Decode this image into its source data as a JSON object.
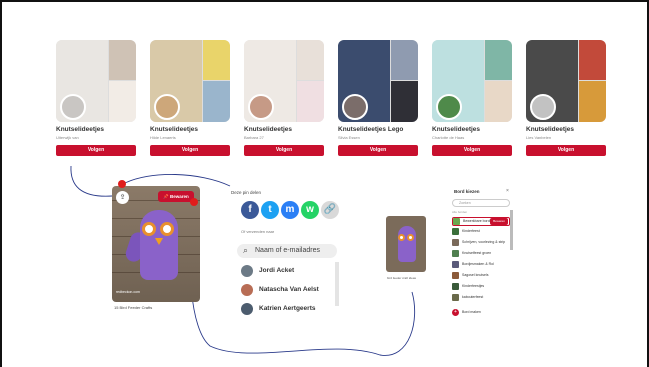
{
  "colors": {
    "accent": "#c8102e",
    "annotation": "#e01c1c",
    "ink": "#2a3a8a"
  },
  "boards": [
    {
      "title": "Knutselideetjes",
      "owner": "Uiterwijk van",
      "follow": "Volgen",
      "img": [
        "#e9e6e2",
        "#cfc2b5",
        "#f2ece6"
      ],
      "avatar": "#c9c6c3"
    },
    {
      "title": "Knutselideetjes",
      "owner": "Hilde Lenaerts",
      "follow": "Volgen",
      "img": [
        "#d9c9a8",
        "#e9d46a",
        "#9ab5cc"
      ],
      "avatar": "#cda77a"
    },
    {
      "title": "Knutselideetjes",
      "owner": "Barbara 27",
      "follow": "Volgen",
      "img": [
        "#eee9e4",
        "#e8e0d9",
        "#f0dfe2"
      ],
      "avatar": "#c69a86"
    },
    {
      "title": "Knutselideetjes Lego",
      "owner": "Silvia Essen",
      "follow": "Volgen",
      "img": [
        "#3b4c6e",
        "#8f9bb0",
        "#2f2f36"
      ],
      "avatar": "#7b6d6a"
    },
    {
      "title": "Knutselideetjes",
      "owner": "Charlotte de Haas",
      "follow": "Volgen",
      "img": [
        "#bde0e0",
        "#7fb6a6",
        "#e8d8c7"
      ],
      "avatar": "#4f8a4a"
    },
    {
      "title": "Knutselideetjes",
      "owner": "Lies Vanbelen",
      "follow": "Volgen",
      "img": [
        "#4a4a4a",
        "#c24a3a",
        "#d79a3a"
      ],
      "avatar": "#c2c2c2"
    }
  ],
  "pin": {
    "share_icon": "upload-icon",
    "share_glyph": "⇪",
    "save_label": "Bewaren",
    "source": "redbeckon.com",
    "caption": "15 Bird Feeder Crafts"
  },
  "share_panel": {
    "header": "Deze pin delen",
    "icons": [
      {
        "name": "facebook-icon",
        "glyph": "f",
        "color": "#3b5998"
      },
      {
        "name": "twitter-icon",
        "glyph": "t",
        "color": "#1da1f2"
      },
      {
        "name": "messenger-icon",
        "glyph": "m",
        "color": "#2b7ff5"
      },
      {
        "name": "whatsapp-icon",
        "glyph": "w",
        "color": "#25d366"
      },
      {
        "name": "link-icon",
        "glyph": "🔗",
        "color": "#d9d9d9"
      }
    ],
    "copy_text": "Of verzenden naar",
    "search_placeholder": "Naam of e-mailadres",
    "contacts": [
      {
        "name": "Jordi Acket",
        "color": "#6c7a86"
      },
      {
        "name": "Natascha Van Aelst",
        "color": "#b86d55"
      },
      {
        "name": "Katrien Aertgeerts",
        "color": "#4c5c6e"
      }
    ]
  },
  "mini_pin": {
    "caption": "bird feeder craft ideas"
  },
  "picker": {
    "header": "Bord kiezen",
    "close": "×",
    "search": "Zoeken",
    "section": "Alle borden",
    "rows": [
      {
        "label": "Bewerkbare borden",
        "color": "#6aa84f",
        "save": "Bewaren"
      },
      {
        "label": "Kinderfeest",
        "color": "#3a6f3a"
      },
      {
        "label": "Schrijven, voorlezing & strip",
        "color": "#7a6a5a"
      },
      {
        "label": "Knutselfeest groen",
        "color": "#4f7f4f"
      },
      {
        "label": "Bordjesmaken & Rol",
        "color": "#5a5a7a"
      },
      {
        "label": "Sagosel knutsels",
        "color": "#8b5a3a"
      },
      {
        "label": "Kinderfeestjes",
        "color": "#3a5a3a"
      },
      {
        "label": "kabouterfeest",
        "color": "#6a6a4a"
      }
    ],
    "create": "Bord maken"
  }
}
